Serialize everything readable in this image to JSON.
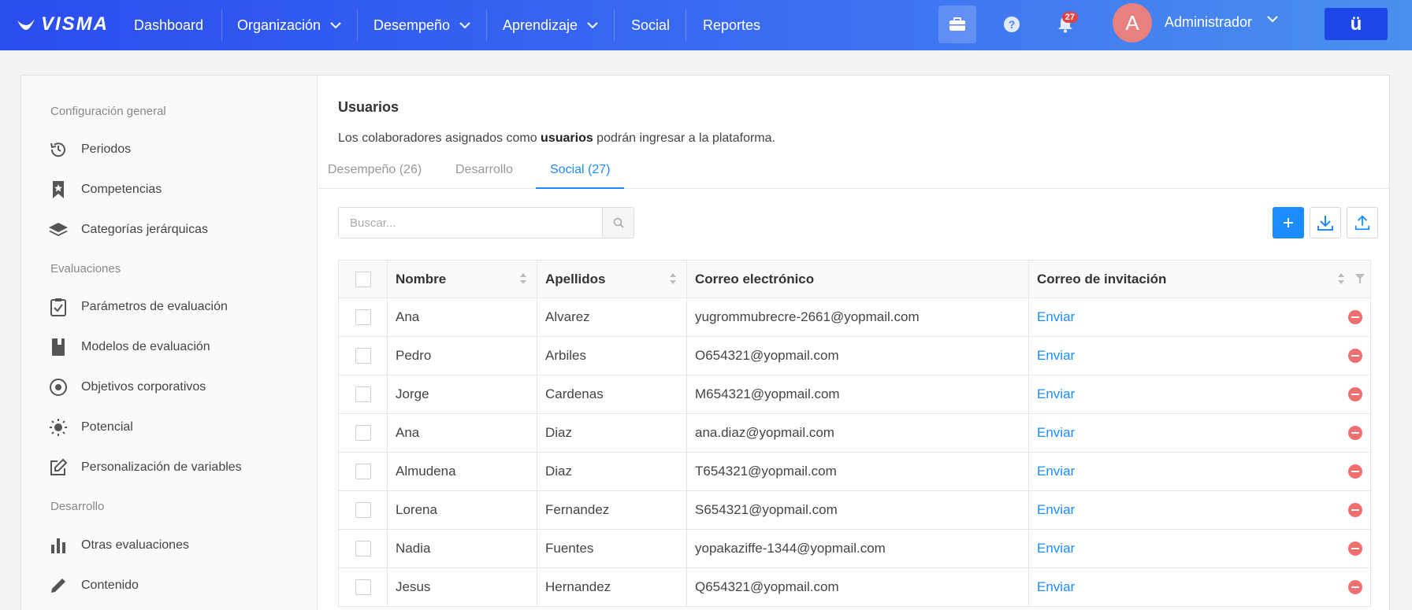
{
  "topbar": {
    "logo": "VISMA",
    "nav": [
      {
        "label": "Dashboard",
        "dropdown": false
      },
      {
        "label": "Organización",
        "dropdown": true
      },
      {
        "label": "Desempeño",
        "dropdown": true
      },
      {
        "label": "Aprendizaje",
        "dropdown": true
      },
      {
        "label": "Social",
        "dropdown": false
      },
      {
        "label": "Reportes",
        "dropdown": false
      }
    ],
    "notifications_count": "27",
    "avatar_letter": "A",
    "user_name": "Administrador",
    "app_button": "ü",
    "colors": {
      "gradient_start": "#2a4dee",
      "gradient_end": "#4a90ee",
      "app_button": "#1e47e8"
    }
  },
  "sidebar": {
    "sections": [
      {
        "title": "Configuración general",
        "items": [
          {
            "label": "Periodos",
            "icon": "history-icon"
          },
          {
            "label": "Competencias",
            "icon": "bookmark-star-icon"
          },
          {
            "label": "Categorías jerárquicas",
            "icon": "layers-icon"
          }
        ]
      },
      {
        "title": "Evaluaciones",
        "items": [
          {
            "label": "Parámetros de evaluación",
            "icon": "clipboard-check-icon"
          },
          {
            "label": "Modelos de evaluación",
            "icon": "book-icon"
          },
          {
            "label": "Objetivos corporativos",
            "icon": "target-icon"
          },
          {
            "label": "Potencial",
            "icon": "lightbulb-icon"
          },
          {
            "label": "Personalización de variables",
            "icon": "edit-icon"
          }
        ]
      },
      {
        "title": "Desarrollo",
        "items": [
          {
            "label": "Otras evaluaciones",
            "icon": "bar-chart-icon"
          },
          {
            "label": "Contenido",
            "icon": "pencil-icon"
          }
        ]
      }
    ]
  },
  "main": {
    "title": "Usuarios",
    "desc_before": "Los colaboradores asignados como ",
    "desc_bold": "usuarios",
    "desc_after": " podrán ingresar a la plataforma.",
    "tabs": [
      {
        "label": "Desempeño (26)",
        "active": false
      },
      {
        "label": "Desarrollo",
        "active": false
      },
      {
        "label": "Social (27)",
        "active": true
      }
    ],
    "search_placeholder": "Buscar...",
    "accent": "#1a8cff",
    "table": {
      "headers": [
        "Nombre",
        "Apellidos",
        "Correo electrónico",
        "Correo de invitación"
      ],
      "rows": [
        {
          "nombre": "Ana",
          "apellidos": "Alvarez",
          "correo": "yugrommubrecre-2661@yopmail.com",
          "invitacion": "Enviar"
        },
        {
          "nombre": "Pedro",
          "apellidos": "Arbiles",
          "correo": "O654321@yopmail.com",
          "invitacion": "Enviar"
        },
        {
          "nombre": "Jorge",
          "apellidos": "Cardenas",
          "correo": "M654321@yopmail.com",
          "invitacion": "Enviar"
        },
        {
          "nombre": "Ana",
          "apellidos": "Diaz",
          "correo": "ana.diaz@yopmail.com",
          "invitacion": "Enviar"
        },
        {
          "nombre": "Almudena",
          "apellidos": "Diaz",
          "correo": "T654321@yopmail.com",
          "invitacion": "Enviar"
        },
        {
          "nombre": "Lorena",
          "apellidos": "Fernandez",
          "correo": "S654321@yopmail.com",
          "invitacion": "Enviar"
        },
        {
          "nombre": "Nadia",
          "apellidos": "Fuentes",
          "correo": "yopakaziffe-1344@yopmail.com",
          "invitacion": "Enviar"
        },
        {
          "nombre": "Jesus",
          "apellidos": "Hernandez",
          "correo": "Q654321@yopmail.com",
          "invitacion": "Enviar"
        }
      ]
    }
  }
}
